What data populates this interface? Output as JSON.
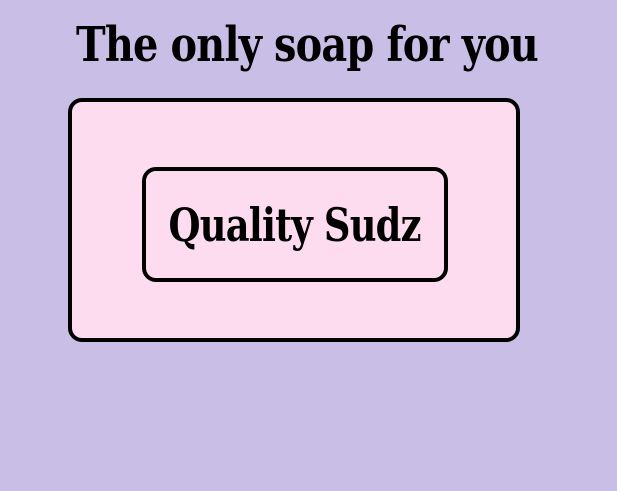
{
  "headline": "The only soap for you",
  "soap": {
    "brand": "Quality Sudz"
  },
  "colors": {
    "background": "#c8bee6",
    "soap_fill": "#fcdcee",
    "outline": "#000000"
  }
}
